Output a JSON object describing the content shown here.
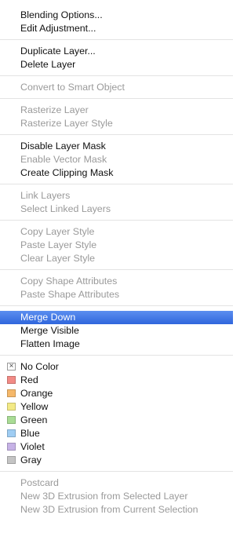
{
  "menu": {
    "groups": [
      [
        {
          "label": "Blending Options...",
          "enabled": true
        },
        {
          "label": "Edit Adjustment...",
          "enabled": true
        }
      ],
      [
        {
          "label": "Duplicate Layer...",
          "enabled": true
        },
        {
          "label": "Delete Layer",
          "enabled": true
        }
      ],
      [
        {
          "label": "Convert to Smart Object",
          "enabled": false
        }
      ],
      [
        {
          "label": "Rasterize Layer",
          "enabled": false
        },
        {
          "label": "Rasterize Layer Style",
          "enabled": false
        }
      ],
      [
        {
          "label": "Disable Layer Mask",
          "enabled": true
        },
        {
          "label": "Enable Vector Mask",
          "enabled": false
        },
        {
          "label": "Create Clipping Mask",
          "enabled": true
        }
      ],
      [
        {
          "label": "Link Layers",
          "enabled": false
        },
        {
          "label": "Select Linked Layers",
          "enabled": false
        }
      ],
      [
        {
          "label": "Copy Layer Style",
          "enabled": false
        },
        {
          "label": "Paste Layer Style",
          "enabled": false
        },
        {
          "label": "Clear Layer Style",
          "enabled": false
        }
      ],
      [
        {
          "label": "Copy Shape Attributes",
          "enabled": false
        },
        {
          "label": "Paste Shape Attributes",
          "enabled": false
        }
      ],
      [
        {
          "label": "Merge Down",
          "enabled": true,
          "highlighted": true
        },
        {
          "label": "Merge Visible",
          "enabled": true
        },
        {
          "label": "Flatten Image",
          "enabled": true
        }
      ],
      [
        {
          "label": "No Color",
          "enabled": true,
          "swatch": "none"
        },
        {
          "label": "Red",
          "enabled": true,
          "swatch": "#f28b86"
        },
        {
          "label": "Orange",
          "enabled": true,
          "swatch": "#f5b86a"
        },
        {
          "label": "Yellow",
          "enabled": true,
          "swatch": "#f3ea86"
        },
        {
          "label": "Green",
          "enabled": true,
          "swatch": "#a9dc95"
        },
        {
          "label": "Blue",
          "enabled": true,
          "swatch": "#9fcdf3"
        },
        {
          "label": "Violet",
          "enabled": true,
          "swatch": "#c6b2e6"
        },
        {
          "label": "Gray",
          "enabled": true,
          "swatch": "#c4c4c4"
        }
      ],
      [
        {
          "label": "Postcard",
          "enabled": false
        },
        {
          "label": "New 3D Extrusion from Selected Layer",
          "enabled": false
        },
        {
          "label": "New 3D Extrusion from Current Selection",
          "enabled": false
        }
      ]
    ]
  }
}
